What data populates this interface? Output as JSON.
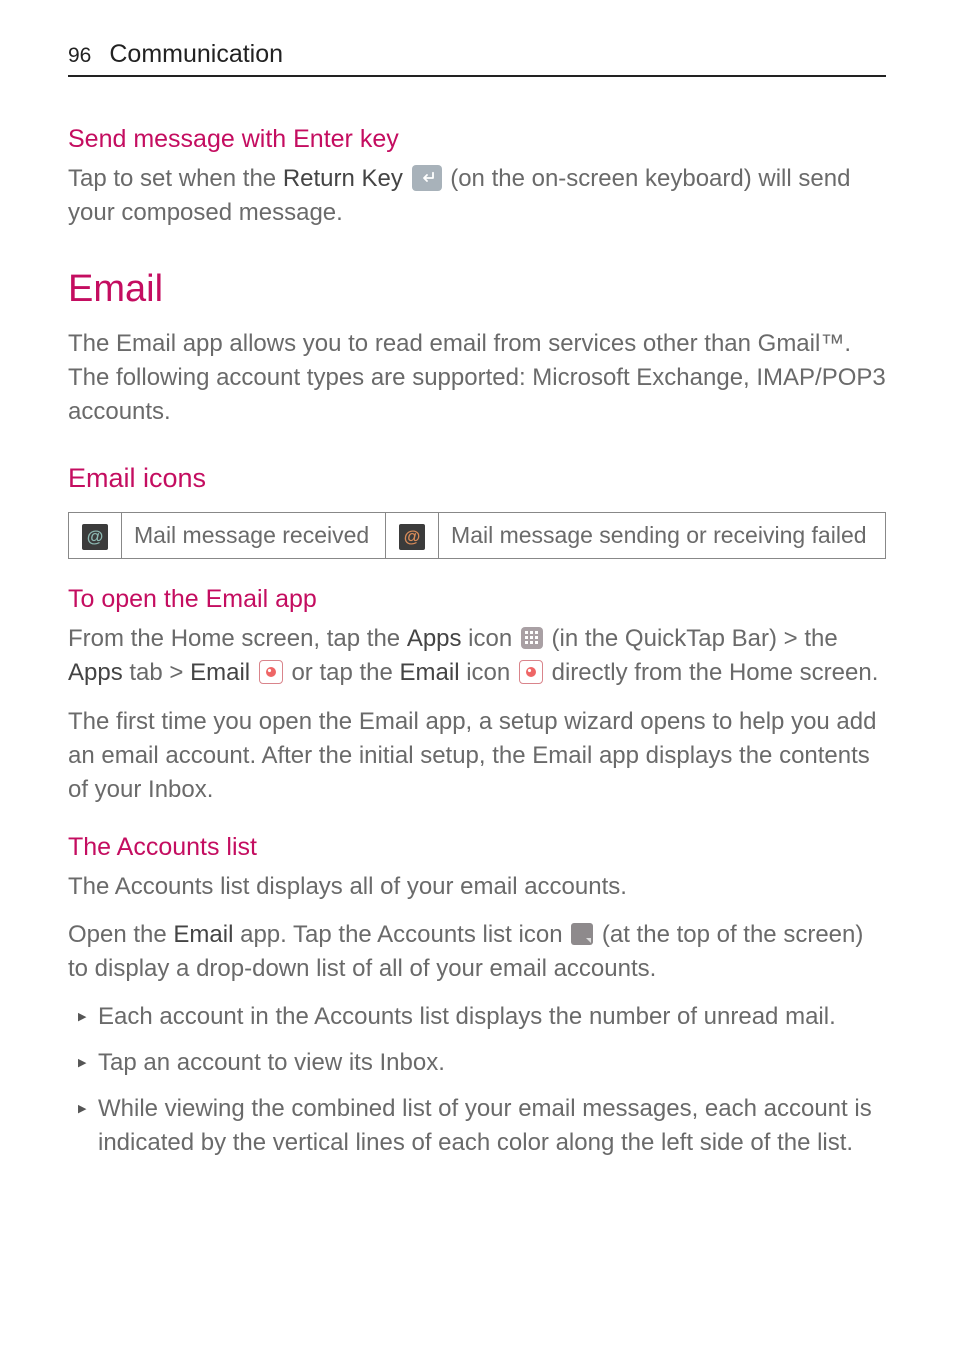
{
  "header": {
    "page_number": "96",
    "section": "Communication"
  },
  "s1": {
    "heading": "Send message with Enter key",
    "p_a": "Tap to set when the ",
    "p_bold": "Return Key",
    "p_b": " (on the on-screen keyboard) will send your composed message."
  },
  "s2": {
    "heading": "Email",
    "p": "The Email app allows you to read email from services other than Gmail™. The following account types are supported: Microsoft Exchange, IMAP/POP3 accounts."
  },
  "s3": {
    "heading": "Email icons",
    "cell1": "Mail message received",
    "cell2": "Mail message sending or receiving failed"
  },
  "s4": {
    "heading": "To open the Email app",
    "p1_a": "From the Home screen, tap the ",
    "p1_b": "Apps",
    "p1_c": " icon ",
    "p1_d": " (in the QuickTap Bar) > the ",
    "p1_e": "Apps",
    "p1_f": " tab > ",
    "p1_g": "Email",
    "p1_h": " or tap the ",
    "p1_i": "Email",
    "p1_j": " icon ",
    "p1_k": " directly from the Home screen.",
    "p2": "The first time you open the Email app, a setup wizard opens to help you add an email account. After the initial setup, the Email app displays the contents of your Inbox."
  },
  "s5": {
    "heading": "The Accounts list",
    "p1": "The Accounts list displays all of your email accounts.",
    "p2_a": "Open the ",
    "p2_b": "Email",
    "p2_c": " app. Tap the Accounts list icon ",
    "p2_d": " (at the top of the screen) to display a drop-down list of all of your email accounts.",
    "b1": "Each account in the Accounts list displays the number of unread mail.",
    "b2": "Tap an account to view its Inbox.",
    "b3": "While viewing the combined list of your email messages, each account is indicated by the vertical lines of each color along the left side of the list."
  }
}
